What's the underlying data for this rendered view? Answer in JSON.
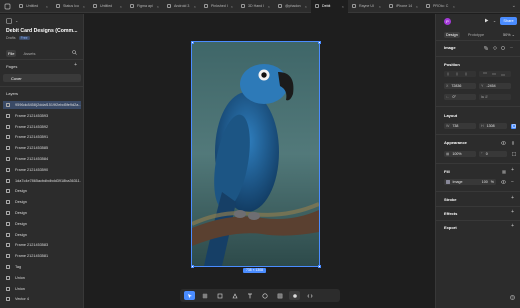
{
  "tabs": [
    {
      "label": "Untitled",
      "active": false
    },
    {
      "label": "Status Ico",
      "active": false
    },
    {
      "label": "Untitled",
      "active": false
    },
    {
      "label": "Figma api",
      "active": false
    },
    {
      "label": "Android 3",
      "active": false
    },
    {
      "label": "Pinkshed I",
      "active": false
    },
    {
      "label": "3D Hand I",
      "active": false
    },
    {
      "label": "@phadon",
      "active": false
    },
    {
      "label": "Debit",
      "active": true
    },
    {
      "label": "Rayne UI",
      "active": false
    },
    {
      "label": "iPhone 14",
      "active": false
    },
    {
      "label": "PROto: C",
      "active": false
    }
  ],
  "left_panel": {
    "file_title": "Debit Card Designs (Comm...",
    "location": "Drafts",
    "plan_badge": "Free",
    "tab_file": "File",
    "tab_assets": "Assets",
    "pages_heading": "Pages",
    "pages": [
      "Cover"
    ],
    "layers_heading": "Layers",
    "layers": [
      {
        "name": "9596dc8458(2ddaf1519f2ebd5fe9d2a...",
        "selected": true
      },
      {
        "name": "Frame 2121453593",
        "selected": false
      },
      {
        "name": "Frame 2121453592",
        "selected": false
      },
      {
        "name": "Frame 2121453591",
        "selected": false
      },
      {
        "name": "Frame 2121453585",
        "selected": false
      },
      {
        "name": "Frame 2121453584",
        "selected": false
      },
      {
        "name": "Frame 2121453590",
        "selected": false
      },
      {
        "name": "1da7c4e7865acbdbdbdd3918ba36311...",
        "selected": false
      },
      {
        "name": "Design",
        "selected": false
      },
      {
        "name": "Design",
        "selected": false
      },
      {
        "name": "Design",
        "selected": false
      },
      {
        "name": "Design",
        "selected": false
      },
      {
        "name": "Design",
        "selected": false
      },
      {
        "name": "Frame 2121453583",
        "selected": false
      },
      {
        "name": "Frame 2121453581",
        "selected": false
      },
      {
        "name": "Tag",
        "selected": false
      },
      {
        "name": "Union",
        "selected": false
      },
      {
        "name": "Union",
        "selected": false
      },
      {
        "name": "Vector 4",
        "selected": false
      }
    ]
  },
  "canvas": {
    "selection_size": "738 × 1308"
  },
  "right_panel": {
    "avatar_initial": "P",
    "share_label": "Share",
    "tab_design": "Design",
    "tab_prototype": "Prototype",
    "zoom": "50%",
    "layer_type": "Image",
    "position_heading": "Position",
    "x_label": "X",
    "x_value": "72836",
    "y_label": "Y",
    "y_value": "-2454",
    "rotation": "0°",
    "layout_heading": "Layout",
    "w_label": "W",
    "w_value": "738",
    "h_label": "H",
    "h_value": "1308",
    "appearance_heading": "Appearance",
    "opacity": "100%",
    "radius": "0",
    "fill_heading": "Fill",
    "fill_type": "Image",
    "fill_opacity": "100",
    "fill_percent": "%",
    "stroke_heading": "Stroke",
    "effects_heading": "Effects",
    "export_heading": "Export"
  },
  "colors": {
    "accent": "#4a8cff",
    "panel": "#2c2c2c",
    "canvas": "#1e1e1e",
    "avatar": "#a43bd9"
  }
}
